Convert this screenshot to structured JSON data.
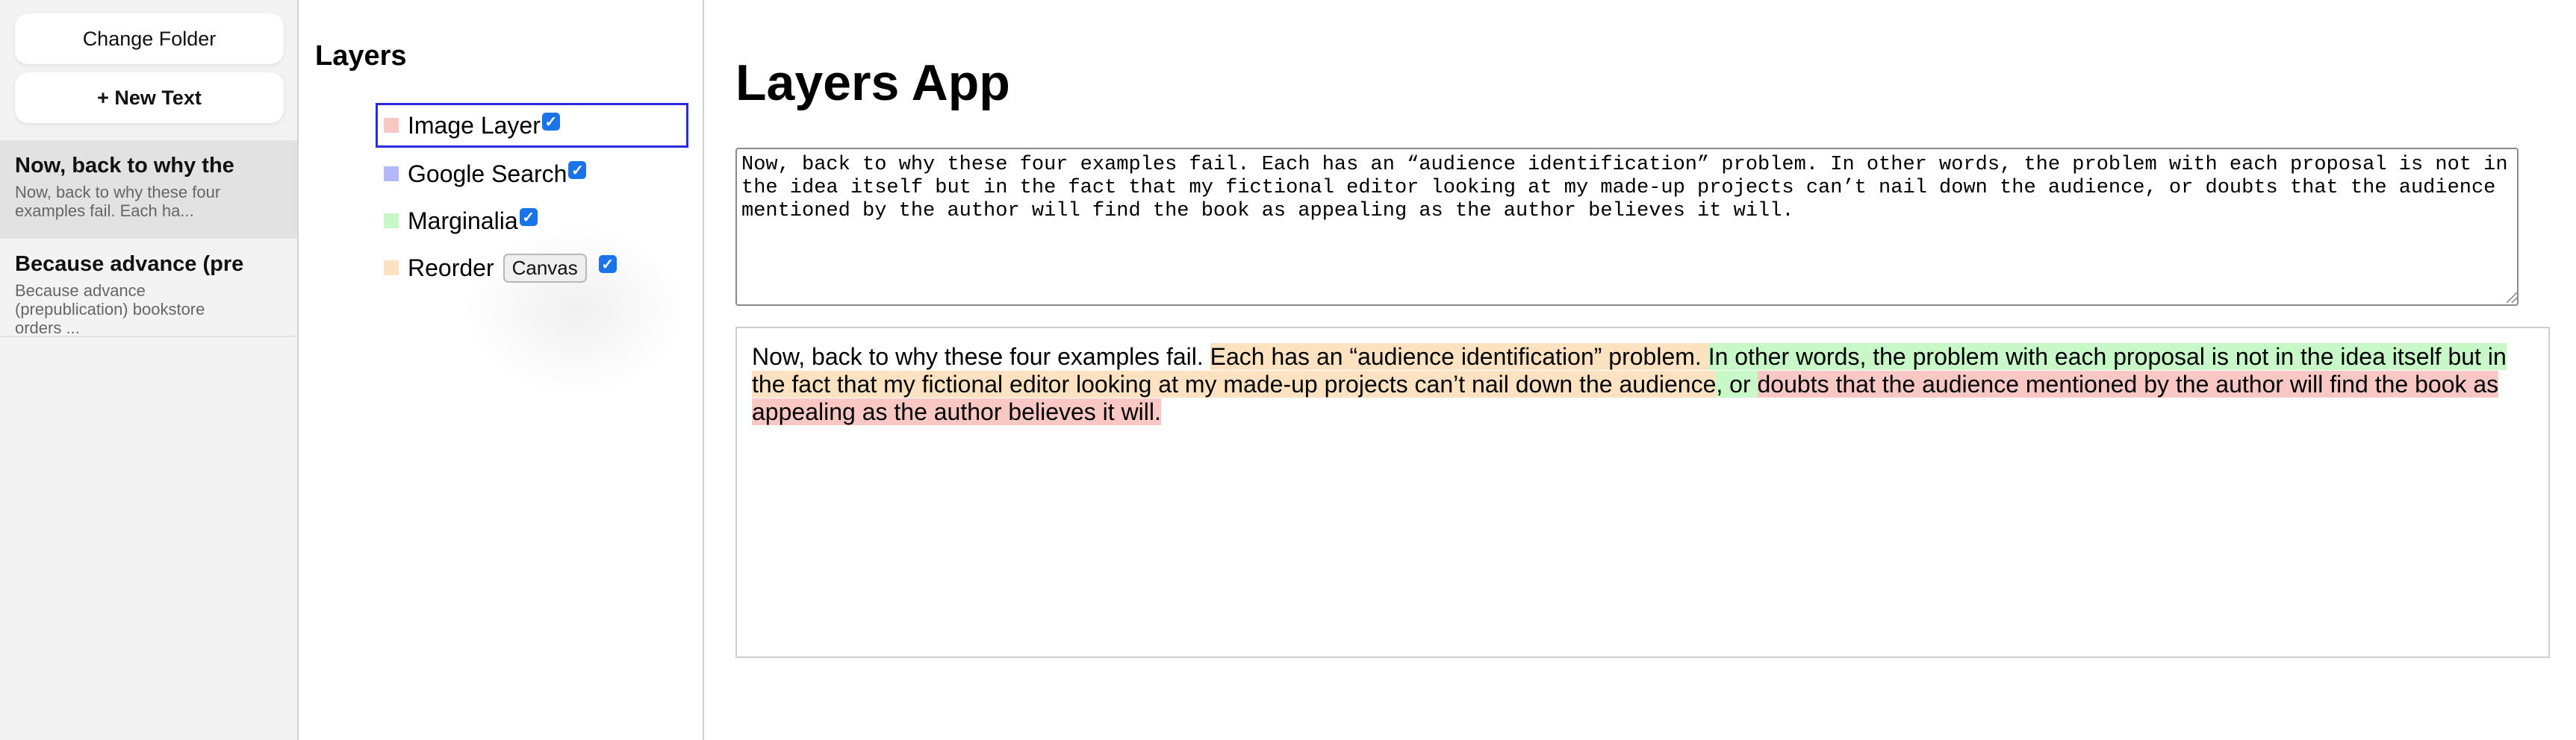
{
  "sidebar": {
    "change_folder_label": "Change Folder",
    "new_text_label": "+ New Text",
    "notes": [
      {
        "title": "Now, back to why the",
        "snippet": "Now, back to why these four examples fail. Each ha..."
      },
      {
        "title": "Because advance (pre",
        "snippet": "Because advance (prepublication) bookstore orders ..."
      }
    ]
  },
  "layers": {
    "heading": "Layers",
    "items": [
      {
        "label": "Image Layer",
        "color": "#f9c8c4",
        "checked": true
      },
      {
        "label": "Google Search",
        "color": "#b3b8f6",
        "checked": true
      },
      {
        "label": "Marginalia",
        "color": "#c8f7c8",
        "checked": true
      },
      {
        "label": "Reorder",
        "color": "#fde2c2",
        "checked": true,
        "button_label": "Canvas"
      }
    ]
  },
  "main": {
    "title": "Layers App",
    "editor_text": "Now, back to why these four examples fail. Each has an “audience identification” problem. In other words, the problem with each proposal is not in the idea itself but in the fact that my fictional editor looking at my made-up projects can’t nail down the audience, or doubts that the audience mentioned by the author will find the book as appealing as the author believes it will.",
    "preview_segments": [
      {
        "text": "Now, back to why these four examples fail. ",
        "color": "transparent"
      },
      {
        "text": "Each has an “audience identification” problem. ",
        "color": "#fde2c2"
      },
      {
        "text": "In other words, the problem with each proposal is not in the idea itself but in",
        "color": "#c8f7c8"
      },
      {
        "text": " ",
        "color": "#fde2c2"
      },
      {
        "text": "the fact that my fictional editor looking at my made-up projects can’t nail down the audience",
        "color": "#fde2c2"
      },
      {
        "text": ", or ",
        "color": "#c8f7c8"
      },
      {
        "text": "doubts that the audience mentioned by the author will find the book as appealing as the author believes it will.",
        "color": "#f9c8c4"
      }
    ]
  },
  "colors": {
    "selected_border": "#2a2ae0",
    "checkbox": "#1a73e8"
  }
}
